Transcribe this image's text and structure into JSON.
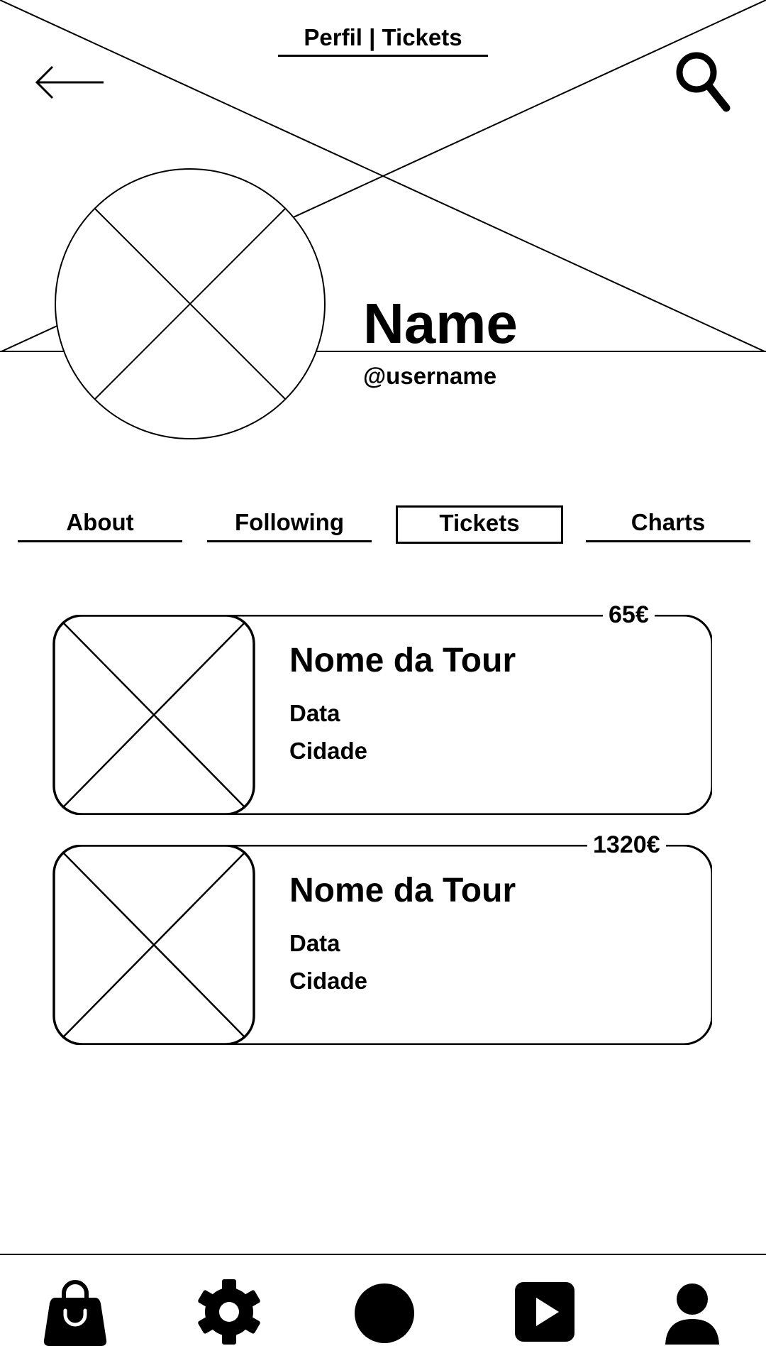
{
  "header": {
    "title": "Perfil | Tickets"
  },
  "profile": {
    "name": "Name",
    "username": "@username"
  },
  "tabs": [
    {
      "label": "About",
      "active": false
    },
    {
      "label": "Following",
      "active": false
    },
    {
      "label": "Tickets",
      "active": true
    },
    {
      "label": "Charts",
      "active": false
    }
  ],
  "tickets": [
    {
      "price": "65€",
      "tour_name": "Nome da Tour",
      "date": "Data",
      "city": "Cidade"
    },
    {
      "price": "1320€",
      "tour_name": "Nome da Tour",
      "date": "Data",
      "city": "Cidade"
    }
  ],
  "icons": {
    "back": "arrow-left-icon",
    "search": "search-icon",
    "nav": [
      "shopping-bag-icon",
      "gear-icon",
      "circle-icon",
      "play-icon",
      "user-icon"
    ]
  },
  "colors": {
    "foreground": "#000000",
    "background": "#ffffff"
  }
}
